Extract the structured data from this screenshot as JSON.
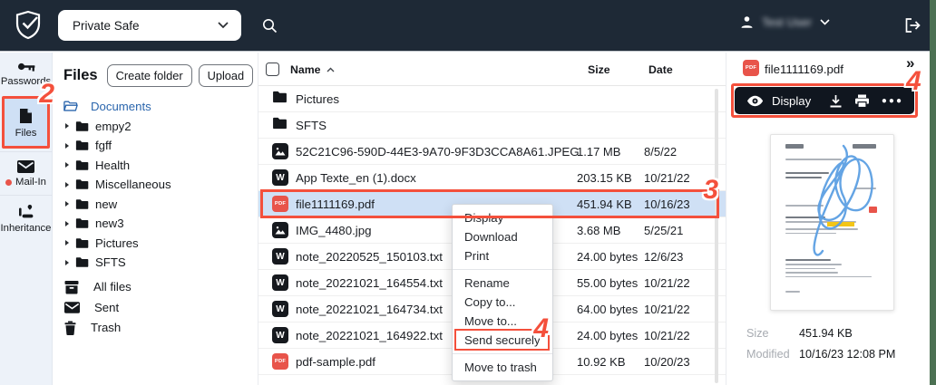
{
  "navbar": {
    "safe_selector_label": "Private Safe",
    "user_name": "Test User"
  },
  "sidebar": {
    "items": [
      {
        "label": "Passwords",
        "icon": "key-icon",
        "active": false
      },
      {
        "label": "Files",
        "icon": "document-icon",
        "active": true
      },
      {
        "label": "Mail-In",
        "icon": "envelope-icon",
        "active": false,
        "notification_dot": true
      },
      {
        "label": "Inheritance",
        "icon": "inheritance-icon",
        "active": false
      }
    ]
  },
  "tree_panel": {
    "title": "Files",
    "buttons": {
      "create_folder": "Create folder",
      "upload": "Upload"
    },
    "root_folder": "Documents",
    "folders": [
      "empy2",
      "fgff",
      "Health",
      "Miscellaneous",
      "new",
      "new3",
      "Pictures",
      "SFTS"
    ],
    "links": [
      {
        "label": "All files",
        "icon": "archive-icon"
      },
      {
        "label": "Sent",
        "icon": "sent-envelope-icon"
      },
      {
        "label": "Trash",
        "icon": "trash-icon"
      }
    ]
  },
  "file_list": {
    "columns": {
      "name": "Name",
      "size": "Size",
      "date": "Date"
    },
    "sort": {
      "column": "Name",
      "direction": "asc"
    },
    "icon_glyphs": {
      "word": "W",
      "pdf": "PDF"
    },
    "rows": [
      {
        "name": "Pictures",
        "type": "folder",
        "size": "",
        "date": "",
        "selected": false
      },
      {
        "name": "SFTS",
        "type": "folder",
        "size": "",
        "date": "",
        "selected": false
      },
      {
        "name": "52C21C96-590D-44E3-9A70-9F3D3CCA8A61.JPEG",
        "type": "image",
        "size": "1.17 MB",
        "date": "8/5/22",
        "selected": false
      },
      {
        "name": "App Texte_en (1).docx",
        "type": "word",
        "size": "203.15 KB",
        "date": "10/21/22",
        "selected": false
      },
      {
        "name": "file1111169.pdf",
        "type": "pdf",
        "size": "451.94 KB",
        "date": "10/16/23",
        "selected": true
      },
      {
        "name": "IMG_4480.jpg",
        "type": "image",
        "size": "3.68 MB",
        "date": "5/25/21",
        "selected": false
      },
      {
        "name": "note_20220525_150103.txt",
        "type": "word",
        "size": "24.00 bytes",
        "date": "12/6/23",
        "selected": false
      },
      {
        "name": "note_20221021_164554.txt",
        "type": "word",
        "size": "55.00 bytes",
        "date": "10/21/22",
        "selected": false
      },
      {
        "name": "note_20221021_164734.txt",
        "type": "word",
        "size": "64.00 bytes",
        "date": "10/21/22",
        "selected": false
      },
      {
        "name": "note_20221021_164922.txt",
        "type": "word",
        "size": "24.00 bytes",
        "date": "10/21/22",
        "selected": false
      },
      {
        "name": "pdf-sample.pdf",
        "type": "pdf",
        "size": "10.92 KB",
        "date": "10/20/23",
        "selected": false
      }
    ]
  },
  "context_menu": {
    "groups": [
      [
        "Display",
        "Download",
        "Print"
      ],
      [
        "Rename",
        "Copy to...",
        "Move to...",
        "Send securely"
      ],
      [
        "Move to trash"
      ]
    ],
    "highlighted_item": "Send securely"
  },
  "preview_panel": {
    "file_name": "file1111169.pdf",
    "toolbar": {
      "display_label": "Display"
    },
    "details": [
      {
        "label": "Size",
        "value": "451.94 KB"
      },
      {
        "label": "Modified",
        "value": "10/16/23 12:08 PM"
      }
    ]
  },
  "annotations": {
    "step2": "2",
    "step3": "3",
    "step4_toolbar": "4",
    "step4_menu": "4"
  },
  "colors": {
    "annotation_red": "#F4503C",
    "selection_blue": "#CFE0F5",
    "navbar_dark": "#1E2936",
    "toolbar_black": "#10161F",
    "pdf_icon_red": "#E8544A",
    "link_blue": "#2B66AD",
    "green_edge": "#4C7153"
  }
}
